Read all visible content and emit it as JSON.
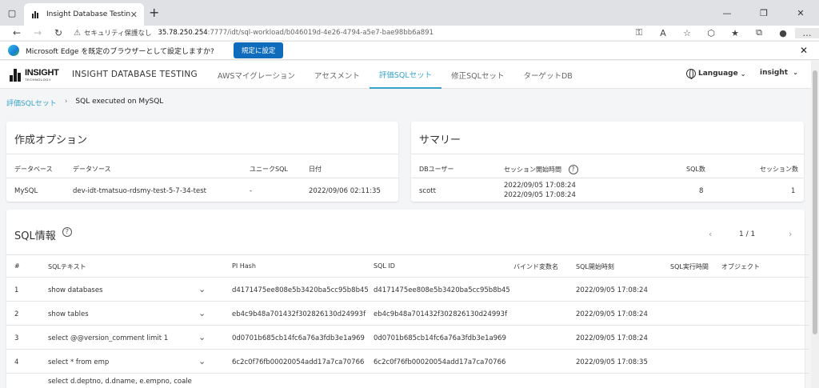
{
  "browser": {
    "tab_title": "Insight Database Testing",
    "url_security": "セキュリティ保護なし",
    "url_host": "35.78.250.254",
    "url_path": ":7777/idt/sql-workload/b046019d-4e26-4794-a5e7-bae98bb6a891",
    "infobar_message": "Microsoft Edge を既定のブラウザーとして設定しますか?",
    "infobar_button": "規定に設定"
  },
  "app": {
    "logo_text": "INSIGHT",
    "logo_sub": "TECHNOLOGY",
    "title": "INSIGHT DATABASE TESTING",
    "menu": [
      "AWSマイグレーション",
      "アセスメント",
      "評価SQLセット",
      "修正SQLセット",
      "ターゲットDB"
    ],
    "active_menu": "評価SQLセット",
    "language": "Language",
    "user": "insight"
  },
  "breadcrumb": {
    "parent": "評価SQLセット",
    "current": "SQL executed on MySQL"
  },
  "options": {
    "title": "作成オプション",
    "headers": [
      "データベース",
      "データソース",
      "ユニークSQL",
      "日付"
    ],
    "row": [
      "MySQL",
      "dev-idt-tmatsuo-rdsmy-test-5-7-34-test",
      "-",
      "2022/09/06 02:11:35"
    ]
  },
  "summary": {
    "title": "サマリー",
    "headers": [
      "DBユーザー",
      "セッション開始時間",
      "SQL数",
      "セッション数"
    ],
    "user": "scott",
    "session_start_1": "2022/09/05 17:08:24",
    "session_start_2": "2022/09/05 17:08:24",
    "sql_count": "8",
    "session_count": "1"
  },
  "sqlinfo": {
    "title": "SQL情報",
    "page": "1 / 1",
    "headers": [
      "#",
      "SQLテキスト",
      "PI Hash",
      "SQL ID",
      "バインド変数名",
      "SQL開始時刻",
      "SQL実行時間",
      "オブジェクト"
    ],
    "rows": [
      {
        "no": "1",
        "text": "show databases",
        "pi_hash": "d4171475ee808e5b3420ba5cc95b8b45",
        "sql_id": "d4171475ee808e5b3420ba5cc95b8b45",
        "start": "2022/09/05 17:08:24"
      },
      {
        "no": "2",
        "text": "show tables",
        "pi_hash": "eb4c9b48a701432f302826130d24993f",
        "sql_id": "eb4c9b48a701432f302826130d24993f",
        "start": "2022/09/05 17:08:24"
      },
      {
        "no": "3",
        "text": "select @@version_comment limit 1",
        "pi_hash": "0d0701b685cb14fc6a76a3fdb3e1a969",
        "sql_id": "0d0701b685cb14fc6a76a3fdb3e1a969",
        "start": "2022/09/05 17:08:24"
      },
      {
        "no": "4",
        "text": "select * from emp",
        "pi_hash": "6c2c0f76fb00020054add17a7ca70766",
        "sql_id": "6c2c0f76fb00020054add17a7ca70766",
        "start": "2022/09/05 17:08:35"
      }
    ],
    "partial_row_text": "select d.deptno, d.dname, e.empno, coale"
  },
  "colors": {
    "accent": "#36a3c9",
    "edge_button": "#0f6cbd"
  }
}
